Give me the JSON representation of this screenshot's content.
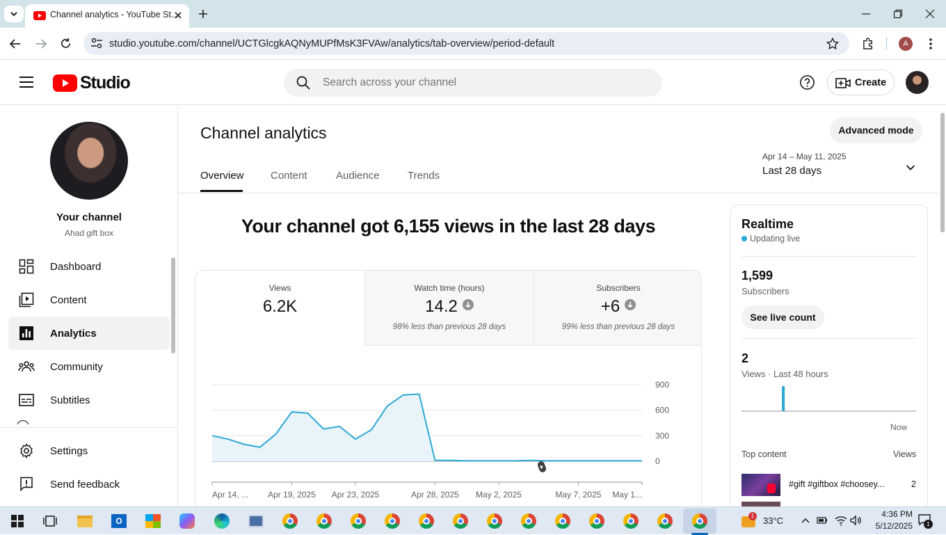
{
  "browser": {
    "tab_title": "Channel analytics - YouTube St...",
    "url": "studio.youtube.com/channel/UCTGlcgkAQNyMUPfMsK3FVAw/analytics/tab-overview/period-default",
    "profile_initial": "A"
  },
  "header": {
    "logo_text": "Studio",
    "search_placeholder": "Search across your channel",
    "create_label": "Create"
  },
  "sidebar": {
    "channel_label": "Your channel",
    "channel_name": "Ahad gift box",
    "items": [
      {
        "label": "Dashboard",
        "icon": "dashboard-icon"
      },
      {
        "label": "Content",
        "icon": "content-icon"
      },
      {
        "label": "Analytics",
        "icon": "analytics-icon",
        "active": true
      },
      {
        "label": "Community",
        "icon": "community-icon"
      },
      {
        "label": "Subtitles",
        "icon": "subtitles-icon"
      }
    ],
    "settings_label": "Settings",
    "feedback_label": "Send feedback"
  },
  "main": {
    "title": "Channel analytics",
    "advanced_label": "Advanced mode",
    "tabs": [
      "Overview",
      "Content",
      "Audience",
      "Trends"
    ],
    "active_tab": "Overview",
    "period_range": "Apr 14 – May 11, 2025",
    "period_label": "Last 28 days",
    "headline": "Your channel got 6,155 views in the last 28 days",
    "metrics": [
      {
        "label": "Views",
        "value": "6.2K",
        "sub": ""
      },
      {
        "label": "Watch time (hours)",
        "value": "14.2",
        "sub": "98% less than previous 28 days"
      },
      {
        "label": "Subscribers",
        "value": "+6",
        "sub": "99% less than previous 28 days"
      }
    ]
  },
  "chart_data": {
    "type": "area",
    "x": [
      "Apr 14",
      "Apr 15",
      "Apr 16",
      "Apr 17",
      "Apr 18",
      "Apr 19",
      "Apr 20",
      "Apr 21",
      "Apr 22",
      "Apr 23",
      "Apr 24",
      "Apr 25",
      "Apr 26",
      "Apr 27",
      "Apr 28",
      "Apr 29",
      "Apr 30",
      "May 1",
      "May 2",
      "May 3",
      "May 4",
      "May 5",
      "May 6",
      "May 7",
      "May 8",
      "May 9",
      "May 10",
      "May 11"
    ],
    "values": [
      300,
      260,
      200,
      165,
      320,
      580,
      565,
      380,
      410,
      260,
      370,
      650,
      780,
      790,
      10,
      10,
      5,
      5,
      5,
      5,
      10,
      5,
      5,
      5,
      5,
      5,
      5,
      5
    ],
    "tick_labels": [
      "Apr 14, ...",
      "Apr 19, 2025",
      "Apr 23, 2025",
      "Apr 28, 2025",
      "May 2, 2025",
      "May 7, 2025",
      "May 1..."
    ],
    "tick_index": [
      0,
      5,
      9,
      14,
      18,
      23,
      27
    ],
    "y_ticks": [
      "900",
      "600",
      "300",
      "0"
    ],
    "ylim": [
      0,
      900
    ],
    "line_color": "#2ba8d4",
    "fill_color": "#e8f4fa"
  },
  "realtime": {
    "title": "Realtime",
    "status": "Updating live",
    "subscribers_value": "1,599",
    "subscribers_label": "Subscribers",
    "see_live_label": "See live count",
    "views_value": "2",
    "views_label": "Views · Last 48 hours",
    "now_label": "Now",
    "top_content_label": "Top content",
    "views_col_label": "Views",
    "top_item_title": "#gift #giftbox #choosey...",
    "top_item_views": "2",
    "bar_values": [
      0,
      0,
      0,
      0,
      0,
      0,
      0,
      0,
      0,
      0,
      0,
      2,
      0,
      0,
      0,
      0,
      0,
      0,
      0,
      0,
      0,
      0,
      0,
      0,
      0,
      0,
      0,
      0,
      0,
      0,
      0,
      0,
      0,
      0,
      0,
      0,
      0,
      0,
      0,
      0,
      0,
      0,
      0,
      0,
      0,
      0,
      0,
      0
    ]
  },
  "taskbar": {
    "temperature": "33°C",
    "time": "4:36 PM",
    "date": "5/12/2025",
    "weather_badge": "1",
    "notif_count": "1"
  }
}
